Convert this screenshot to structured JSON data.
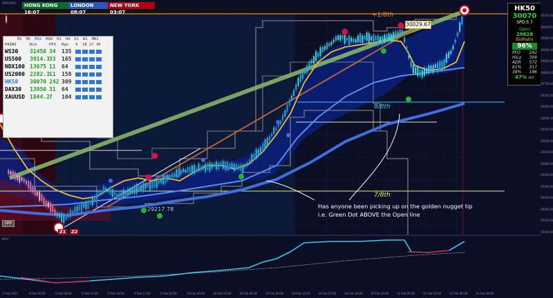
{
  "sessions": [
    {
      "city": "HONG KONG",
      "time": "16:07",
      "color": "#0b6a2a"
    },
    {
      "city": "LONDON",
      "time": "08:07",
      "color": "#2a56b8"
    },
    {
      "city": "NEW YORK",
      "time": "03:07",
      "color": "#b00010"
    }
  ],
  "top_left_label": "HK50,M15",
  "sub_window_label": "MO3",
  "pairs_table": {
    "timeframes": [
      "M1",
      "M5",
      "M15",
      "M30",
      "H1",
      "H4",
      "D1",
      "W1",
      "MN1"
    ],
    "headers": {
      "symbol": "PAIRS",
      "bid": "Bid",
      "pfo": "PFO",
      "range": "Rge",
      "tf_numbers": [
        "9",
        "18",
        "27",
        "36"
      ]
    },
    "rows": [
      {
        "symbol": "WS30",
        "bid": "31458",
        "pfo": "34",
        "range": "135",
        "symbol_color": "#000000"
      },
      {
        "symbol": "US500",
        "bid": "3914.3",
        "pfo": "33",
        "range": "165",
        "symbol_color": "#000000"
      },
      {
        "symbol": "NDX100",
        "bid": "13675",
        "pfo": "11",
        "range": "64",
        "symbol_color": "#000000"
      },
      {
        "symbol": "US2000",
        "bid": "2282.3",
        "pfo": "11",
        "range": "158",
        "symbol_color": "#000000"
      },
      {
        "symbol": "HK50",
        "bid": "30070",
        "pfo": "242",
        "range": "309",
        "symbol_color": "#2f76d9"
      },
      {
        "symbol": "DAX30",
        "bid": "13950",
        "pfo": "31",
        "range": "64",
        "symbol_color": "#000000"
      },
      {
        "symbol": "XAUUSD",
        "bid": "1844.2",
        "pfo": "7",
        "range": "104",
        "symbol_color": "#000000"
      }
    ]
  },
  "right_panel": {
    "symbol": "HK50",
    "price": "30070",
    "spread": "SPD:5.7",
    "open_label": "Open",
    "open_value": "29828",
    "bid_ratio_label": "BidRatio",
    "bid_ratio_value": "96%",
    "stats": [
      {
        "label": "PFO",
        "value": "242"
      },
      {
        "label": "HiLo",
        "value": "309"
      },
      {
        "label": "ADR",
        "value": "572"
      },
      {
        "label": "61%",
        "value": "317"
      },
      {
        "label": "38%",
        "value": "196"
      }
    ],
    "adr_pct": "47%",
    "adr_suffix": "ADR"
  },
  "levels": {
    "top": "+1/8th",
    "mid": "8/8th",
    "low": "7/8th"
  },
  "price_tags": {
    "high": "30029.67",
    "low": "29217.78"
  },
  "annotation": {
    "line1": "Has anyone been picking up on the golden nugget tip",
    "line2": "i.e. Green Dot ABOVE the Open line"
  },
  "badges": {
    "opp": "OPP",
    "z1": "Z1",
    "z2": "Z2"
  },
  "price_scale": [
    "30100.00",
    "30029.67",
    "29950.00",
    "29900.00",
    "29850.00",
    "29800.00",
    "29750.00",
    "29700.00",
    "29650.00",
    "29600.00",
    "29550.00",
    "29500.00",
    "29450.00",
    "29400.00",
    "29350.00",
    "29300.00",
    "29250.00",
    "29200.00",
    "29150.00",
    "29100.00"
  ],
  "time_axis": [
    "9 Feb 2021",
    "9 Feb 05:00",
    "9 Feb 08:00",
    "9 Feb 11:00",
    "9 Feb 14:00",
    "9 Feb 17:00",
    "9 Feb 20:00",
    "10 Feb 00:00",
    "10 Feb 03:00",
    "10 Feb 06:00",
    "10 Feb 09:00",
    "10 Feb 12:00",
    "10 Feb 15:00",
    "10 Feb 18:00",
    "10 Feb 21:00",
    "11 Feb 00:00",
    "11 Feb 03:00",
    "11 Feb 06:00",
    "11 Feb 09:00"
  ]
}
